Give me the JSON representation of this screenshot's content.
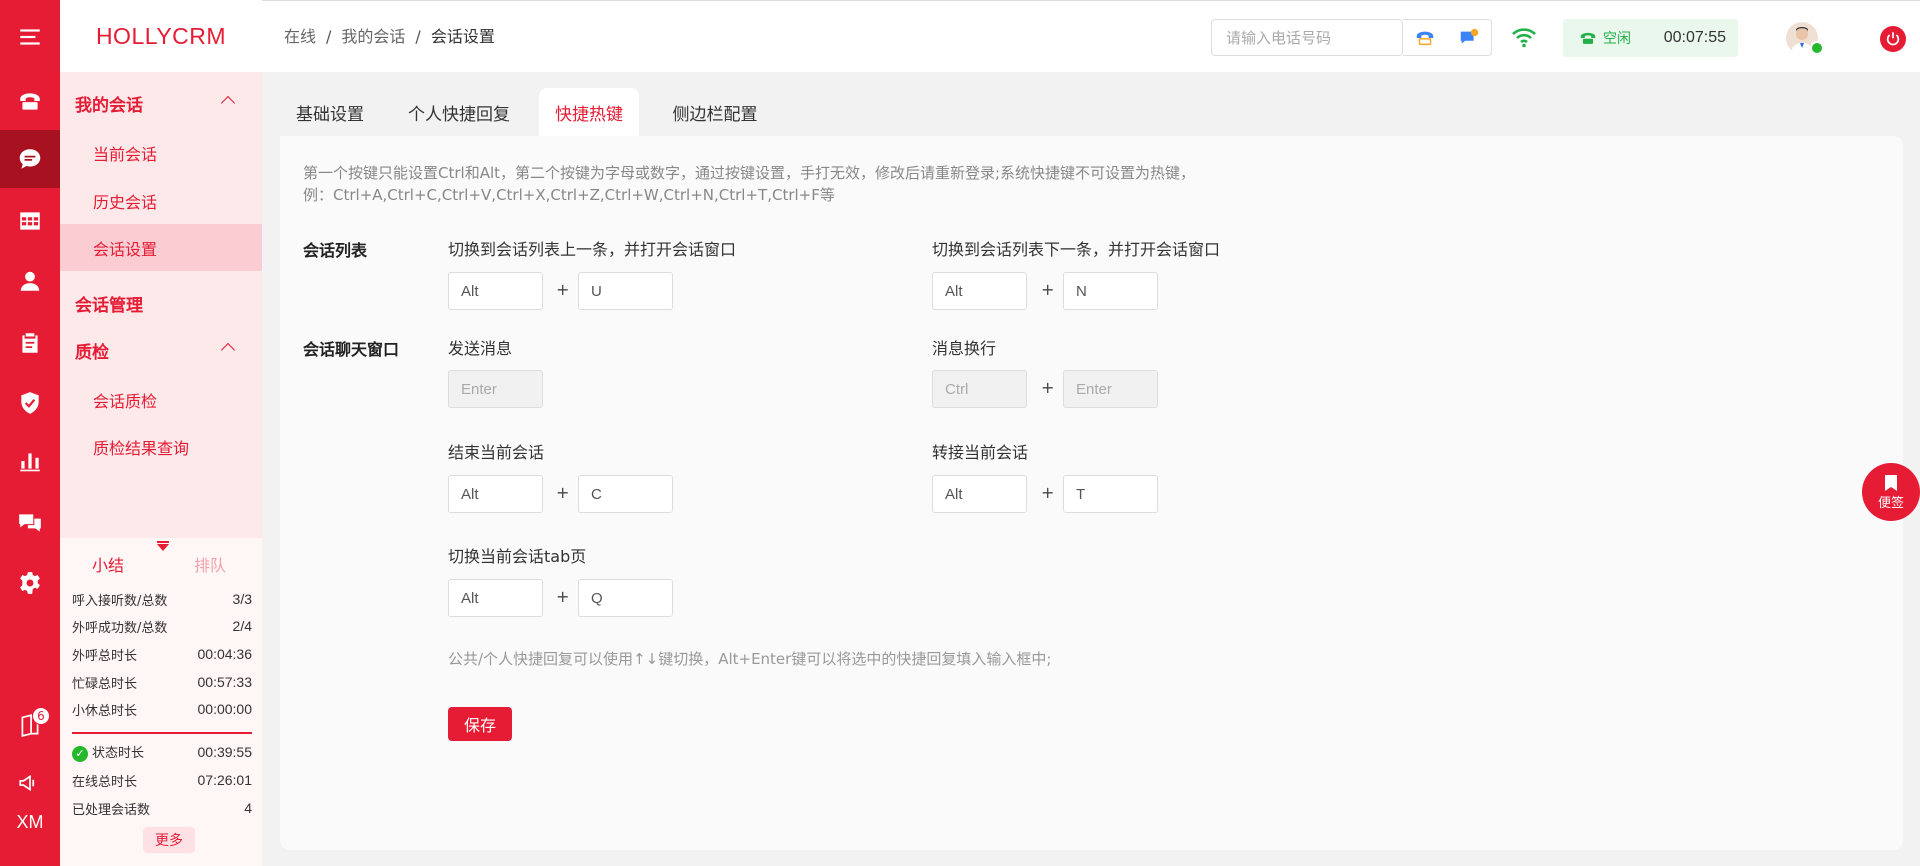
{
  "brand": "HOLLYCRM",
  "rail": {
    "badge": "6",
    "xm": "XM"
  },
  "sidebar": {
    "group_my": "我的会话",
    "items_my": [
      "当前会话",
      "历史会话",
      "会话设置"
    ],
    "group_manage": "会话管理",
    "group_qc": "质检",
    "items_qc": [
      "会话质检",
      "质检结果查询"
    ]
  },
  "stats": {
    "tab_summary": "小结",
    "tab_queue": "排队",
    "rows": [
      {
        "label": "呼入接听数/总数",
        "value": "3/3"
      },
      {
        "label": "外呼成功数/总数",
        "value": "2/4"
      },
      {
        "label": "外呼总时长",
        "value": "00:04:36"
      },
      {
        "label": "忙碌总时长",
        "value": "00:57:33"
      },
      {
        "label": "小休总时长",
        "value": "00:00:00"
      }
    ],
    "rows2": [
      {
        "label": "状态时长",
        "value": "00:39:55"
      },
      {
        "label": "在线总时长",
        "value": "07:26:01"
      },
      {
        "label": "已处理会话数",
        "value": "4"
      }
    ],
    "more": "更多"
  },
  "header": {
    "crumbs": [
      "在线",
      "我的会话",
      "会话设置"
    ],
    "phone_placeholder": "请输入电话号码",
    "status": "空闲",
    "timer": "00:07:55"
  },
  "tabs": [
    "基础设置",
    "个人快捷回复",
    "快捷热键",
    "侧边栏配置"
  ],
  "notice_line1": "第一个按键只能设置Ctrl和Alt，第二个按键为字母或数字，通过按键设置，手打无效，修改后请重新登录;系统快捷键不可设置为热键，",
  "notice_line2": "例：Ctrl+A,Ctrl+C,Ctrl+V,Ctrl+X,Ctrl+Z,Ctrl+W,Ctrl+N,Ctrl+T,Ctrl+F等",
  "sections": {
    "list_title": "会话列表",
    "chat_title": "会话聊天窗口"
  },
  "fields": {
    "prev": {
      "label": "切换到会话列表上一条，并打开会话窗口",
      "k1": "Alt",
      "k2": "U"
    },
    "next": {
      "label": "切换到会话列表下一条，并打开会话窗口",
      "k1": "Alt",
      "k2": "N"
    },
    "send": {
      "label": "发送消息",
      "k1": "Enter"
    },
    "newline": {
      "label": "消息换行",
      "k1": "Ctrl",
      "k2": "Enter"
    },
    "end": {
      "label": "结束当前会话",
      "k1": "Alt",
      "k2": "C"
    },
    "transfer": {
      "label": "转接当前会话",
      "k1": "Alt",
      "k2": "T"
    },
    "switch_tab": {
      "label": "切换当前会话tab页",
      "k1": "Alt",
      "k2": "Q"
    },
    "plus": "+"
  },
  "tip": "公共/个人快捷回复可以使用↑↓键切换，Alt+Enter键可以将选中的快捷回复填入输入框中;",
  "save_label": "保存",
  "sticky_label": "便签"
}
